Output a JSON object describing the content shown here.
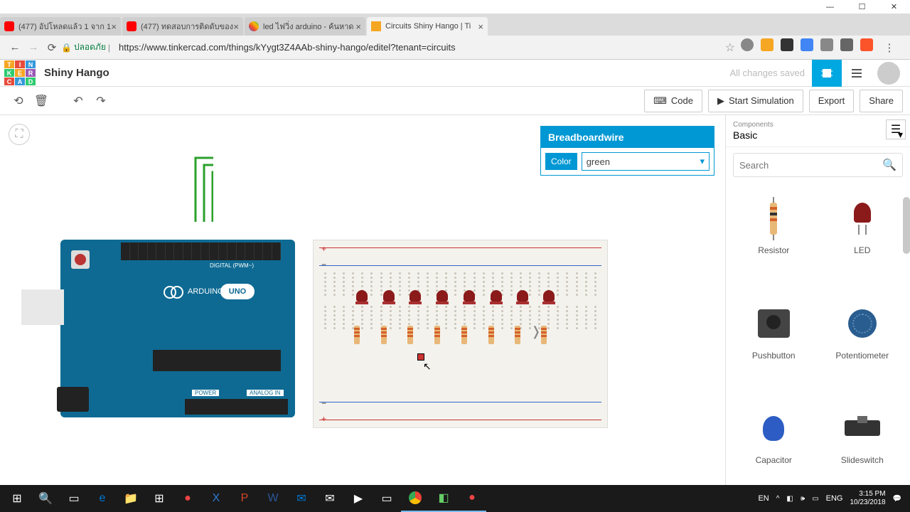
{
  "window": {
    "min": "—",
    "max": "☐",
    "close": "✕"
  },
  "browser": {
    "tabs": [
      {
        "label": "(477) อัปโหลดแล้ว 1 จาก 1",
        "icon": "yt"
      },
      {
        "label": "(477) ทดสอบการติดดับของ",
        "icon": "yt"
      },
      {
        "label": "led ไฟวิ่ง arduino - ค้นหาด",
        "icon": "g"
      },
      {
        "label": "Circuits Shiny Hango | Ti",
        "icon": "tc",
        "active": true
      }
    ],
    "secure": "ปลอดภัย",
    "url": "https://www.tinkercad.com/things/kYygt3Z4AAb-shiny-hango/editel?tenant=circuits"
  },
  "app": {
    "title": "Shiny Hango",
    "status": "All changes saved",
    "toolbar": {
      "code": "Code",
      "sim": "Start Simulation",
      "export": "Export",
      "share": "Share"
    }
  },
  "inspector": {
    "title": "Breadboardwire",
    "color_label": "Color",
    "color_value": "green"
  },
  "panel": {
    "group_label": "Components",
    "group_value": "Basic",
    "search_ph": "Search",
    "items": [
      "Resistor",
      "LED",
      "Pushbutton",
      "Potentiometer",
      "Capacitor",
      "Slideswitch"
    ]
  },
  "arduino": {
    "brand": "ARDUINO",
    "model": "UNO",
    "digital": "DIGITAL (PWM~)",
    "power": "POWER",
    "analog": "ANALOG IN"
  },
  "taskbar": {
    "lang1": "EN",
    "lang2": "ENG",
    "time": "3:15 PM",
    "date": "10/23/2018"
  }
}
